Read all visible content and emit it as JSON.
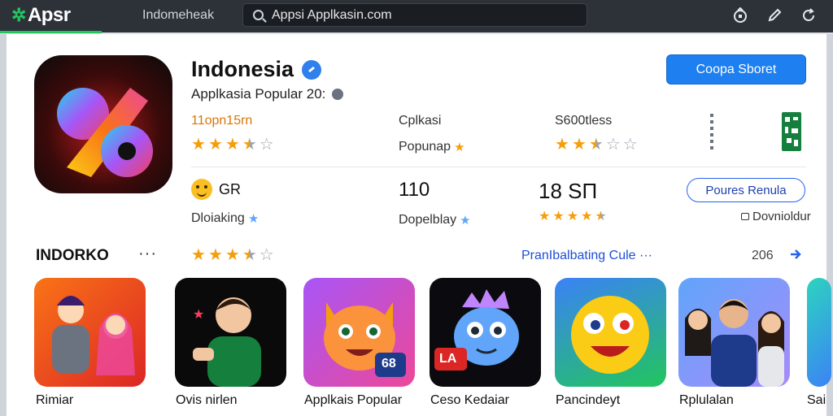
{
  "topbar": {
    "logo_text": "Apsr",
    "nav_title": "Indomeheak",
    "search_value": "Appsi Applkasin.com",
    "icons": [
      "lock-icon",
      "edit-icon",
      "refresh-icon"
    ]
  },
  "app": {
    "name": "Indonesia",
    "subtitle": "Applkasia Popular 20:",
    "primary_button": "Coopa Sboret"
  },
  "stats": {
    "col1": {
      "label": "11opn15rn",
      "rating": 3.5
    },
    "col2": {
      "label": "Cplkasi",
      "sub": "Popunap"
    },
    "col3": {
      "label": "S600tless",
      "rating": 2.5
    }
  },
  "row2": {
    "col1": {
      "main": "GR",
      "sub": "Dloiaking"
    },
    "col2": {
      "main": "110",
      "sub": "Dopelblay"
    },
    "col3": {
      "main": "18 SП",
      "rating": 4.5
    },
    "outline_button": "Poures Renula",
    "note": "Dovnioldur"
  },
  "section": {
    "title": "INDORKO",
    "more": "···",
    "rating": 3.5,
    "link": "PranIbalbating Cule",
    "link_more": "···",
    "count": "206"
  },
  "tiles": [
    {
      "label": "Rimiar"
    },
    {
      "label": "Ovis nirlen"
    },
    {
      "label": "Applkais Popular",
      "badge": "68"
    },
    {
      "label": "Ceso Kedaiar",
      "badge": "LA"
    },
    {
      "label": "Pancindeyt"
    },
    {
      "label": "Rplulalan"
    },
    {
      "label": "Sai"
    }
  ],
  "colors": {
    "accent": "#1d7ff0",
    "brand_green": "#22c55e",
    "star": "#f59e0b",
    "topbar_bg": "#2d3239"
  }
}
